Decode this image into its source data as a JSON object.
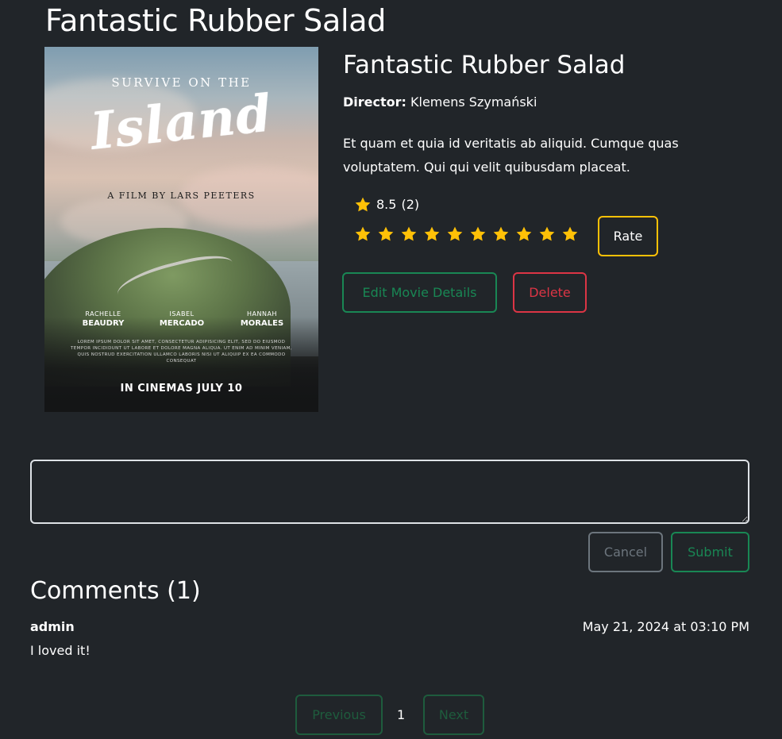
{
  "page": {
    "title": "Fantastic Rubber Salad"
  },
  "poster": {
    "tagline": "SURVIVE ON THE",
    "title_script": "Island",
    "byline": "A FILM BY LARS PEETERS",
    "cast": [
      {
        "first": "RACHELLE",
        "last": "BEAUDRY"
      },
      {
        "first": "ISABEL",
        "last": "MERCADO"
      },
      {
        "first": "HANNAH",
        "last": "MORALES"
      }
    ],
    "fine_print": "LOREM IPSUM DOLOR SIT AMET, CONSECTETUR ADIPISICING ELIT, SED DO EIUSMOD TEMPOR INCIDIDUNT UT LABORE ET DOLORE MAGNA ALIQUA. UT ENIM AD MINIM VENIAM, QUIS NOSTRUD EXERCITATION ULLAMCO LABORIS NISI UT ALIQUIP EX EA COMMODO CONSEQUAT",
    "release": "IN CINEMAS JULY 10"
  },
  "movie": {
    "title": "Fantastic Rubber Salad",
    "director_label": "Director:",
    "director": "Klemens Szymański",
    "description": "Et quam et quia id veritatis ab aliquid. Cumque quas voluptatem. Qui qui velit quibusdam placeat.",
    "rating": "8.5",
    "rating_count": "(2)",
    "star_count": 10,
    "star_color": "#ffc107"
  },
  "actions": {
    "rate_label": "Rate",
    "edit_label": "Edit Movie Details",
    "delete_label": "Delete"
  },
  "comment_form": {
    "value": "",
    "cancel_label": "Cancel",
    "submit_label": "Submit"
  },
  "comments": {
    "heading": "Comments (1)",
    "items": [
      {
        "author": "admin",
        "date": "May 21, 2024 at 03:10 PM",
        "text": "I loved it!"
      }
    ]
  },
  "pagination": {
    "prev_label": "Previous",
    "current_page": "1",
    "next_label": "Next"
  },
  "colors": {
    "background": "#212529",
    "success": "#198754",
    "danger": "#dc3545",
    "warning": "#ffc107",
    "secondary": "#6c757d"
  }
}
